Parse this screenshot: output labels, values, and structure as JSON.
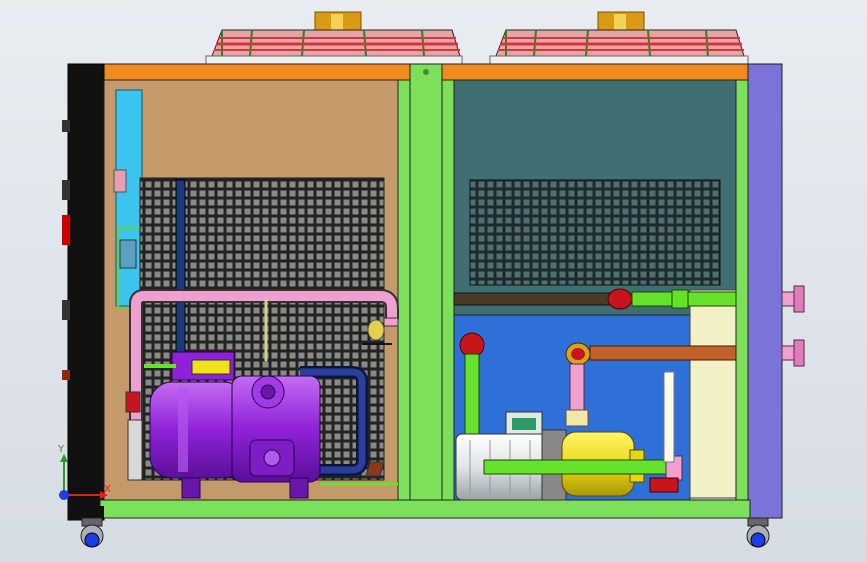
{
  "triad": {
    "x_label": "X",
    "y_label": "Y",
    "colors": {
      "x": "#e0201c",
      "y": "#2a9a2a",
      "z": "#1c3ee8"
    }
  },
  "colors": {
    "frame_orange": "#f08a1c",
    "frame_green": "#7de05a",
    "frame_purple": "#7a73d8",
    "door_black": "#111111",
    "compressor_bay": "#c49a6a",
    "pump_bay_top": "#3f6f73",
    "pump_bay_bottom": "#2f6fd8",
    "compressor": "#9b2fe0",
    "pipe_pink": "#f0a0d0",
    "pipe_green": "#66e22c",
    "pipe_red": "#c8141c",
    "pipe_brown": "#c0622a",
    "pump_yellow": "#f2e21c",
    "tank_cream": "#f1f0c6",
    "fan_red": "#d8343e",
    "fan_gold": "#e0b21c"
  },
  "icons": [
    "fan-guard-icon",
    "compressor-icon",
    "pump-motor-icon",
    "caster-wheel-icon",
    "coordinate-triad-icon"
  ]
}
